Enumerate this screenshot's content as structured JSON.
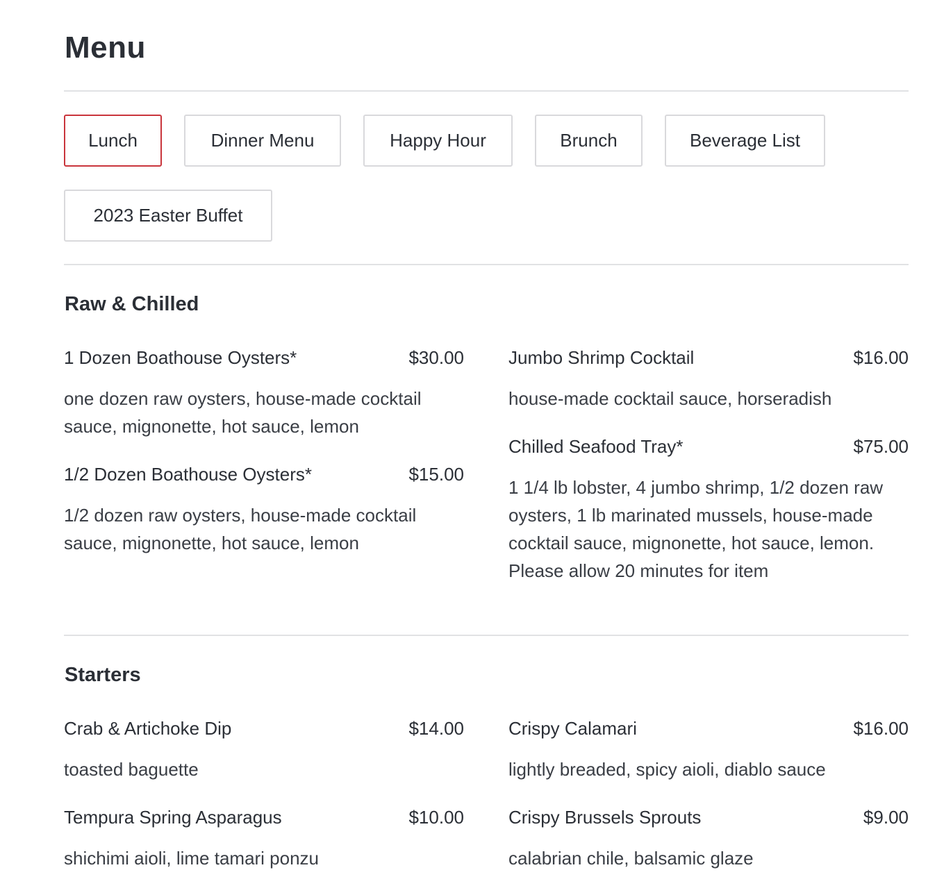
{
  "page_title": "Menu",
  "tabs": [
    {
      "label": "Lunch",
      "active": true
    },
    {
      "label": "Dinner Menu",
      "active": false
    },
    {
      "label": "Happy Hour",
      "active": false
    },
    {
      "label": "Brunch",
      "active": false
    },
    {
      "label": "Beverage List",
      "active": false
    },
    {
      "label": "2023 Easter Buffet",
      "active": false
    }
  ],
  "sections": [
    {
      "title": "Raw & Chilled",
      "items": [
        {
          "name": "1 Dozen Boathouse Oysters*",
          "price": "$30.00",
          "description": "one dozen raw oysters, house-made cocktail sauce, mignonette, hot sauce, lemon"
        },
        {
          "name": "Jumbo Shrimp Cocktail",
          "price": "$16.00",
          "description": "house-made cocktail sauce, horseradish"
        },
        {
          "name": "1/2 Dozen Boathouse Oysters*",
          "price": "$15.00",
          "description": "1/2 dozen raw oysters, house-made cocktail sauce, mignonette, hot sauce, lemon"
        },
        {
          "name": "Chilled Seafood Tray*",
          "price": "$75.00",
          "description": "1 1/4 lb lobster, 4 jumbo shrimp, 1/2 dozen raw oysters, 1 lb marinated mussels, house-made cocktail sauce, mignonette, hot sauce, lemon. Please allow 20 minutes for item"
        }
      ]
    },
    {
      "title": "Starters",
      "items": [
        {
          "name": "Crab & Artichoke Dip",
          "price": "$14.00",
          "description": "toasted baguette"
        },
        {
          "name": "Crispy Calamari",
          "price": "$16.00",
          "description": "lightly breaded, spicy aioli, diablo sauce"
        },
        {
          "name": "Tempura Spring Asparagus",
          "price": "$10.00",
          "description": "shichimi aioli, lime tamari ponzu"
        },
        {
          "name": "Crispy Brussels Sprouts",
          "price": "$9.00",
          "description": "calabrian chile, balsamic glaze"
        }
      ]
    }
  ],
  "colors": {
    "active_tab_border": "#c9353c",
    "tab_border": "#d9d9dc",
    "divider": "#e1e2e4",
    "text": "#2b2f36"
  }
}
